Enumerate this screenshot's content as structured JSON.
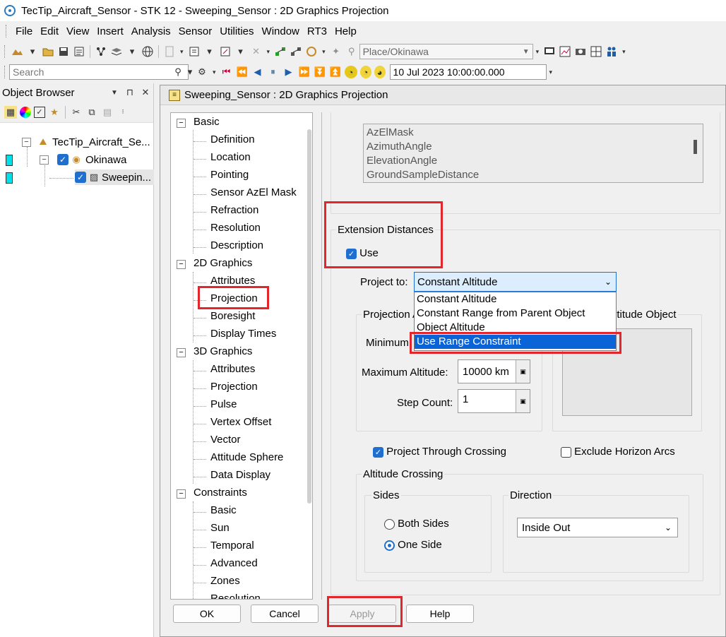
{
  "window": {
    "title": "TecTip_Aircraft_Sensor - STK 12 - Sweeping_Sensor : 2D Graphics Projection"
  },
  "menu": [
    "File",
    "Edit",
    "View",
    "Insert",
    "Analysis",
    "Sensor",
    "Utilities",
    "Window",
    "RT3",
    "Help"
  ],
  "toolbar": {
    "location": "Place/Okinawa"
  },
  "toolbar2": {
    "search_placeholder": "Search",
    "time": "10 Jul 2023 10:00:00.000"
  },
  "object_browser": {
    "title": "Object Browser",
    "tree": [
      {
        "label": "TecTip_Aircraft_Se..."
      },
      {
        "label": "Okinawa"
      },
      {
        "label": "Sweepin..."
      }
    ]
  },
  "dialog": {
    "title": "Sweeping_Sensor : 2D Graphics Projection",
    "nav": [
      {
        "label": "Basic",
        "group": true
      },
      {
        "label": "Definition"
      },
      {
        "label": "Location"
      },
      {
        "label": "Pointing"
      },
      {
        "label": "Sensor AzEl Mask"
      },
      {
        "label": "Refraction"
      },
      {
        "label": "Resolution"
      },
      {
        "label": "Description"
      },
      {
        "label": "2D Graphics",
        "group": true
      },
      {
        "label": "Attributes"
      },
      {
        "label": "Projection"
      },
      {
        "label": "Boresight"
      },
      {
        "label": "Display Times"
      },
      {
        "label": "3D Graphics",
        "group": true
      },
      {
        "label": "Attributes"
      },
      {
        "label": "Projection"
      },
      {
        "label": "Pulse"
      },
      {
        "label": "Vertex Offset"
      },
      {
        "label": "Vector"
      },
      {
        "label": "Attitude Sphere"
      },
      {
        "label": "Data Display"
      },
      {
        "label": "Constraints",
        "group": true
      },
      {
        "label": "Basic"
      },
      {
        "label": "Sun"
      },
      {
        "label": "Temporal"
      },
      {
        "label": "Advanced"
      },
      {
        "label": "Zones"
      },
      {
        "label": "Resolution"
      }
    ],
    "list_items": [
      "AzElMask",
      "AzimuthAngle",
      "ElevationAngle",
      "GroundSampleDistance"
    ],
    "extension": {
      "title": "Extension Distances",
      "use_label": "Use",
      "project_to_label": "Project to:",
      "project_to_value": "Constant Altitude",
      "options": [
        "Constant Altitude",
        "Constant Range from Parent Object",
        "Object Altitude",
        "Use Range Constraint"
      ],
      "projection_group": "Projection A",
      "object_group": "ltitude Object",
      "min_label": "Minimum",
      "max_label": "Maximum Altitude:",
      "max_value": "10000 km",
      "step_label": "Step Count:",
      "step_value": "1"
    },
    "project_through": "Project Through Crossing",
    "exclude_horizon": "Exclude Horizon Arcs",
    "altitude_crossing": {
      "title": "Altitude Crossing",
      "sides_title": "Sides",
      "both": "Both Sides",
      "one": "One Side",
      "direction_title": "Direction",
      "direction_value": "Inside Out"
    },
    "buttons": {
      "ok": "OK",
      "cancel": "Cancel",
      "apply": "Apply",
      "help": "Help"
    }
  },
  "colors": {
    "highlight": "#e3262b",
    "selection": "#0a64d8"
  }
}
